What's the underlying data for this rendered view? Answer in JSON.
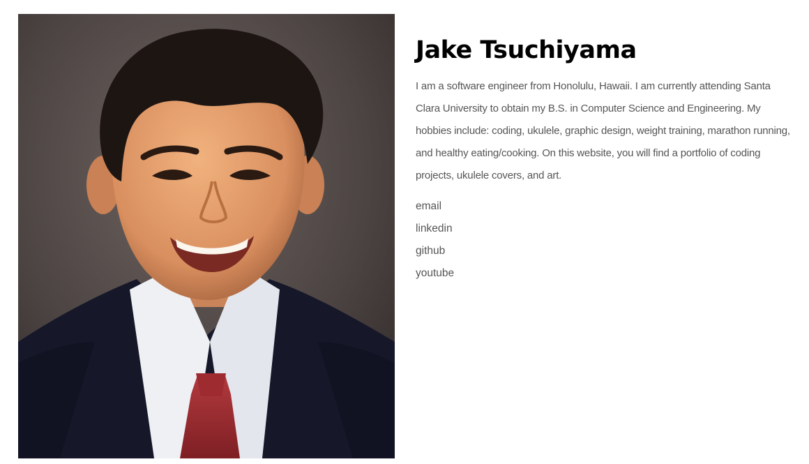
{
  "profile": {
    "name": "Jake Tsuchiyama",
    "bio": "I am a software engineer from Honolulu, Hawaii. I am currently attending Santa Clara University to obtain my B.S. in Computer Science and Engineering. My hobbies include: coding, ukulele, graphic design, weight training, marathon running, and healthy eating/cooking. On this website, you will find a portfolio of coding projects, ukulele covers, and art."
  },
  "links": [
    {
      "label": "email"
    },
    {
      "label": "linkedin"
    },
    {
      "label": "github"
    },
    {
      "label": "youtube"
    }
  ],
  "colors": {
    "heading": "#000000",
    "body_text": "#555555",
    "background": "#ffffff"
  },
  "icons": {
    "photo": "profile-portrait"
  }
}
